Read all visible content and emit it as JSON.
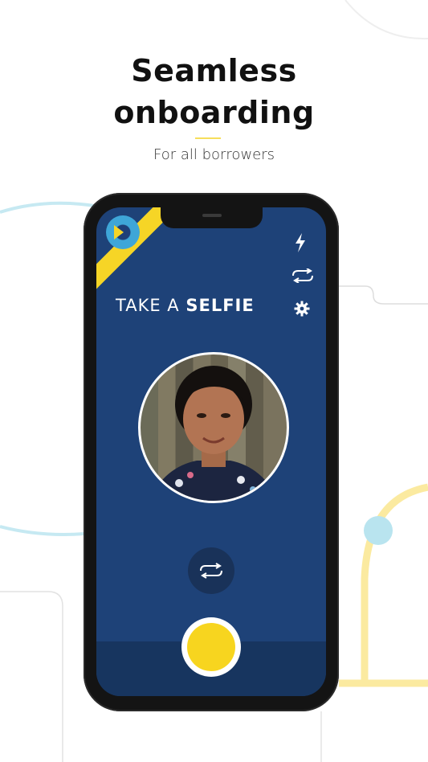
{
  "headline": {
    "line1": "Seamless",
    "line2": "onboarding"
  },
  "subtitle": "For all borrowers",
  "camera": {
    "title_regular": "TAKE A",
    "title_bold": "SELFIE",
    "icons": [
      "flash-icon",
      "switch-camera-icon",
      "settings-gear-icon",
      "switch-camera-icon",
      "shutter-button"
    ]
  },
  "colors": {
    "screen_background": "#1e4278",
    "accent_yellow": "#f6d526",
    "deco_blue": "#b9e4ef",
    "deco_yellow": "#fbeaa0"
  }
}
